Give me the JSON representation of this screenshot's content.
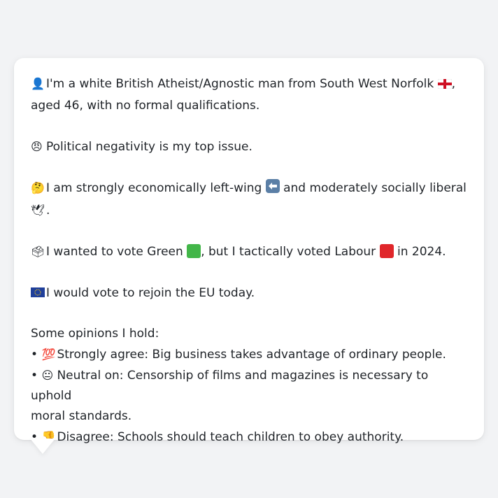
{
  "colors": {
    "background": "#f2f3f5",
    "card": "#ffffff",
    "green_square": "#43b649",
    "red_square": "#e0262a",
    "eu_blue": "#1f3f9a",
    "eu_star": "#f5cc1a"
  },
  "profile": {
    "intro": {
      "icon": "person-silhouette-icon",
      "text_1": "I'm a white British Atheist/Agnostic man from South West Norfolk",
      "flag_icon": "england-flag-icon",
      "text_2": ",",
      "text_3": "aged 46, with no formal qualifications."
    },
    "top_issue": {
      "icon": "angry-face-icon",
      "text": "Political negativity is my top issue."
    },
    "ideology": {
      "icon": "thinking-face-icon",
      "text_1": "I am strongly economically left-wing",
      "left_arrow_icon": "left-arrow-icon",
      "text_2": "and moderately socially liberal",
      "dove_icon": "dove-icon",
      "text_3": "."
    },
    "vote": {
      "icon": "ballot-box-icon",
      "text_1": "I wanted to vote Green",
      "green_icon": "green-square-icon",
      "text_2": ", but I tactically voted Labour",
      "red_icon": "red-square-icon",
      "text_3": "in 2024."
    },
    "eu": {
      "icon": "eu-flag-icon",
      "text": "I would vote to rejoin the EU today."
    },
    "opinions": {
      "heading": "Some opinions I hold:",
      "bullet": "•",
      "items": [
        {
          "icon": "hundred-points-icon",
          "emoji": "💯",
          "text": "Strongly agree: Big business takes advantage of ordinary people."
        },
        {
          "icon": "neutral-face-icon",
          "emoji": "😐",
          "text": "Neutral on: Censorship of films and magazines is necessary to uphold"
        },
        {
          "icon": "",
          "emoji": "",
          "text": "moral standards."
        },
        {
          "icon": "thumbs-down-icon",
          "emoji": "👎",
          "text": "Disagree: Schools should teach children to obey authority."
        }
      ]
    }
  }
}
